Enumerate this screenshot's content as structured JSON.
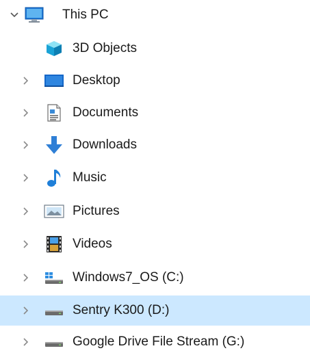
{
  "tree": {
    "root": {
      "label": "This PC",
      "expanded": true,
      "icon": "computer-icon"
    },
    "items": [
      {
        "label": "3D Objects",
        "icon": "3d-objects-icon",
        "has_children": false
      },
      {
        "label": "Desktop",
        "icon": "desktop-icon",
        "has_children": true
      },
      {
        "label": "Documents",
        "icon": "documents-icon",
        "has_children": true
      },
      {
        "label": "Downloads",
        "icon": "downloads-icon",
        "has_children": true
      },
      {
        "label": "Music",
        "icon": "music-icon",
        "has_children": true
      },
      {
        "label": "Pictures",
        "icon": "pictures-icon",
        "has_children": true
      },
      {
        "label": "Videos",
        "icon": "videos-icon",
        "has_children": true
      },
      {
        "label": "Windows7_OS (C:)",
        "icon": "windows-drive-icon",
        "has_children": true
      },
      {
        "label": "Sentry K300 (D:)",
        "icon": "drive-icon",
        "has_children": true,
        "selected": true
      },
      {
        "label": "Google Drive File Stream (G:)",
        "icon": "drive-icon",
        "has_children": true
      }
    ]
  },
  "colors": {
    "selection": "#cce8ff",
    "chevron": "#7a7a7a",
    "folder_blue": "#2f7fd6"
  }
}
